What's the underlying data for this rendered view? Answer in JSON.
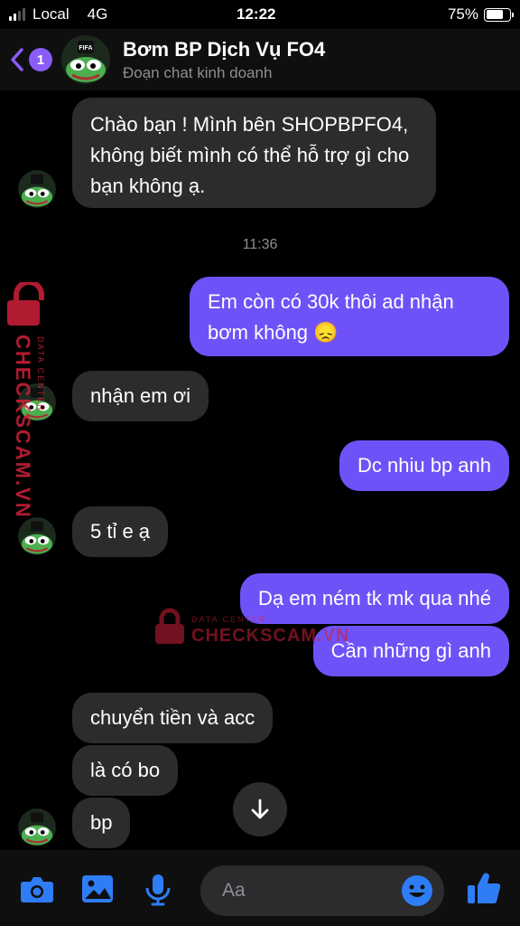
{
  "status_bar": {
    "carrier": "Local",
    "network": "4G",
    "time": "12:22",
    "battery": "75%",
    "battery_level": 0.75
  },
  "header": {
    "back_badge": "1",
    "title": "Bơm BP Dịch Vụ FO4",
    "subtitle": "Đoạn chat kinh doanh",
    "avatar_icon": "fifa-pepe-avatar"
  },
  "messages": [
    {
      "from": "them",
      "text": "Chào bạn ! Mình bên SHOPBPFO4, không biết mình có thể hỗ trợ gì cho bạn không ạ."
    },
    {
      "timestamp": "11:36"
    },
    {
      "from": "me",
      "text": "Em còn có 30k thôi ad nhận bơm không 😞"
    },
    {
      "from": "them",
      "text": "nhận em ơi"
    },
    {
      "from": "me",
      "text": "Dc nhiu bp anh"
    },
    {
      "from": "them",
      "text": "5 tỉ e ạ"
    },
    {
      "from": "me",
      "text": "Dạ em ném tk mk qua nhé"
    },
    {
      "from": "me",
      "text": "Cần những gì anh"
    },
    {
      "from": "them",
      "text": "chuyển tiền và acc"
    },
    {
      "from": "them",
      "text": "là có bo"
    },
    {
      "from": "them",
      "text": "bp"
    }
  ],
  "watermark": {
    "brand": "CHECKSCAM.VN",
    "tagline": "DATA CENTER"
  },
  "composer": {
    "placeholder": "Aa"
  },
  "colors": {
    "outgoing": "#6f52f7",
    "incoming": "#2c2c2e",
    "accent": "#2f7df6"
  }
}
